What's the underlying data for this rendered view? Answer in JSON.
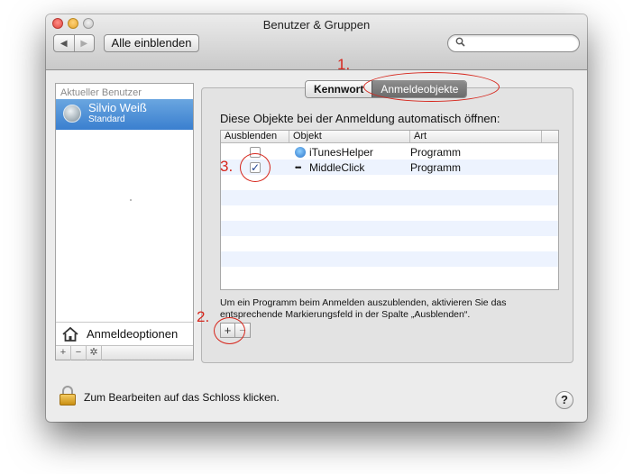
{
  "window": {
    "title": "Benutzer & Gruppen",
    "nav_back": "◀",
    "nav_forward": "▶",
    "show_all_label": "Alle einblenden",
    "search_placeholder": ""
  },
  "sidebar": {
    "header": "Aktueller Benutzer",
    "user": {
      "name": "Silvio Weiß",
      "role": "Standard"
    },
    "login_options_label": "Anmeldeoptionen",
    "toolbar": {
      "add": "+",
      "remove": "−",
      "settings": "✲"
    }
  },
  "tabs": [
    {
      "label": "Kennwort",
      "selected": false
    },
    {
      "label": "Anmeldeobjekte",
      "selected": true
    }
  ],
  "login_items": {
    "heading": "Diese Objekte bei der Anmeldung automatisch öffnen:",
    "columns": [
      "Ausblenden",
      "Objekt",
      "Art"
    ],
    "rows": [
      {
        "hide": false,
        "hide_mark": "",
        "name": "iTunesHelper",
        "icon": "itunes-helper-icon",
        "kind": "Programm"
      },
      {
        "hide": true,
        "hide_mark": "✓",
        "name": "MiddleClick",
        "icon": "middleclick-icon",
        "kind": "Programm"
      }
    ],
    "empty_rows": 7,
    "hint": "Um ein Programm beim Anmelden auszublenden, aktivieren Sie das entsprechende Markierungsfeld in der Spalte „Ausblenden“.",
    "add_label": "+",
    "remove_label": "−"
  },
  "footer": {
    "lock_text": "Zum Bearbeiten auf das Schloss klicken.",
    "help_label": "?"
  },
  "annotations": [
    "1.",
    "2.",
    "3."
  ],
  "colors": {
    "annotation": "#d6261c",
    "selection": "#3a7fcf",
    "row_stripe": "#edf3fe"
  }
}
